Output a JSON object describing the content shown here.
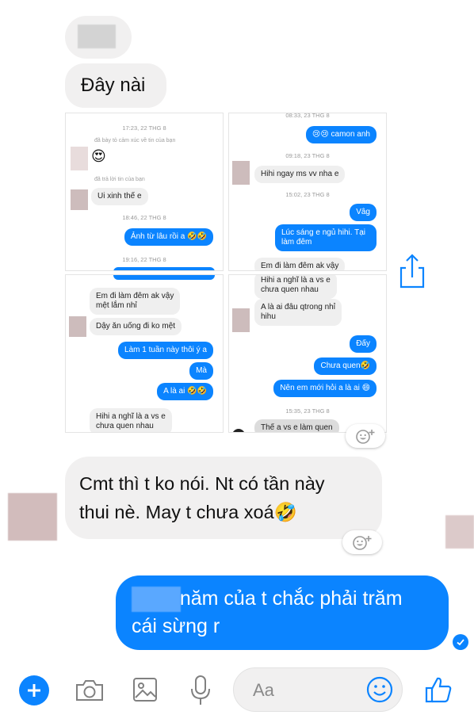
{
  "messages": {
    "m1": "Đây nài",
    "m2_line1": "Cmt thì t ko nói. Nt có tần này",
    "m2_line2": "thui nè. May t chưa xoá🤣",
    "m3_line1": "4 năm của t chắc phải trăm",
    "m3_line2": "cái sừng r"
  },
  "screenshots": {
    "s1": {
      "ts1": "17:23, 22 THG 8",
      "sys1": "đã bày tỏ cảm xúc về tin của bạn",
      "emoji": "😍",
      "sys2": "đã trả lời tin của bạn",
      "msg1": "Ui xinh thế e",
      "ts2": "18:46, 22 THG 8",
      "msg2": "Ảnh từ lâu rồi a 🤣🤣",
      "ts3": "19:16, 22 THG 8"
    },
    "s2": {
      "ts1": "08:33, 23 THG 8",
      "msg1": "😢😢 camon anh",
      "ts2": "09:18, 23 THG 8",
      "msg2": "Hihi ngay ms vv nha e",
      "ts3": "15:02, 23 THG 8",
      "msg3": "Vâg",
      "msg4a": "Lúc sáng e ngủ hihi. Tại",
      "msg4b": "làm đêm",
      "msg5": "Em đi làm đêm ak vậy"
    },
    "s3": {
      "msg1a": "Em đi làm đêm ak vậy",
      "msg1b": "mệt lắm nhỉ",
      "msg2": "Dậy ăn uống đi ko mệt",
      "msg3": "Làm 1 tuần này thôi ý a",
      "msg4": "Mà",
      "msg5": "A là ai 🤣🤣",
      "msg6a": "Hihi a nghĩ là a vs e",
      "msg6b": "chưa quen nhau"
    },
    "s4": {
      "msg1a": "Hihi a nghĩ là a vs e",
      "msg1b": "chưa quen nhau",
      "msg2a": "A là ai đâu qtrong nhỉ",
      "msg2b": "hihu",
      "msg3": "Đấy",
      "msg4": "Chưa quen🤣",
      "msg5": "Nên em mới hỏi a là ai 😄",
      "ts1": "15:35, 23 THG 8",
      "msg6": "Thế a vs e làm quen"
    }
  },
  "composer": {
    "placeholder": "Aa"
  },
  "colors": {
    "accent": "#0b84ff",
    "incoming_bubble": "#f1f0f0"
  },
  "icons": [
    "plus-icon",
    "camera-icon",
    "image-icon",
    "microphone-icon",
    "emoji-icon",
    "thumbs-up-icon",
    "share-icon",
    "add-reaction-icon",
    "seen-check-icon"
  ]
}
